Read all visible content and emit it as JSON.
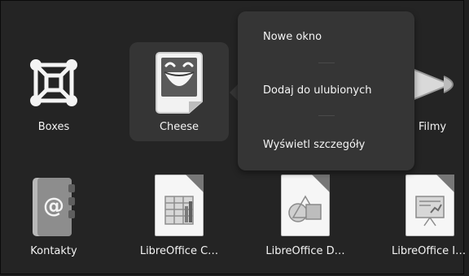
{
  "apps": {
    "boxes": "Boxes",
    "cheese": "Cheese",
    "filmy": "Filmy",
    "kontakty": "Kontakty",
    "libreoffice_calc": "LibreOffice C…",
    "libreoffice_draw": "LibreOffice D…",
    "libreoffice_impress": "LibreOffice I…"
  },
  "context_menu": {
    "new_window": "Nowe okno",
    "add_favorites": "Dodaj do ulubionych",
    "show_details": "Wyświetl szczegóły"
  },
  "icons": {
    "boxes": "boxes-app-icon",
    "cheese": "cheese-app-icon",
    "filmy": "videos-app-icon",
    "kontakty": "contacts-app-icon",
    "calc": "libreoffice-calc-icon",
    "draw": "libreoffice-draw-icon",
    "impress": "libreoffice-impress-icon"
  }
}
